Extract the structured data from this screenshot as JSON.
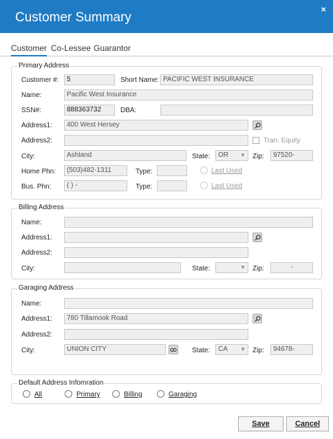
{
  "window": {
    "title": "Customer Summary",
    "close_glyph": "×"
  },
  "tabs": [
    "Customer",
    "Co-Lessee",
    "Guarantor"
  ],
  "primary": {
    "title": "Primary Address",
    "customer_no_label": "Customer #:",
    "customer_no": "5",
    "short_name_label": "Short Name:",
    "short_name": "PACIFIC WEST INSURANCE",
    "name_label": "Name:",
    "name": "Pacific West Insurance",
    "ssn_label": "SSN#:",
    "ssn": "888363732",
    "dba_label": "DBA:",
    "dba": "",
    "address1_label": "Address1:",
    "address1": "400 West Hersey",
    "address2_label": "Address2:",
    "address2": "",
    "tran_equity_label": "Tran. Equity",
    "city_label": "City:",
    "city": "Ashland",
    "state_label": "State:",
    "state": "OR",
    "zip_label": "Zip:",
    "zip": "97520-",
    "home_phn_label": "Home Phn:",
    "home_phn": "(503)482-1311",
    "type_label": "Type:",
    "home_type": "",
    "bus_phn_label": "Bus. Phn:",
    "bus_phn": "(  )   -",
    "bus_type": "",
    "last_used_label": "Last Used"
  },
  "billing": {
    "title": "Billing Address",
    "name_label": "Name:",
    "address1_label": "Address1:",
    "address2_label": "Address2:",
    "city_label": "City:",
    "state_label": "State:",
    "zip_label": "Zip:",
    "zip": "-"
  },
  "garaging": {
    "title": "Garaging Address",
    "name_label": "Name:",
    "address1_label": "Address1:",
    "address1": "780 Tillamook Road",
    "address2_label": "Address2:",
    "city_label": "City:",
    "city": "UNION CITY",
    "state_label": "State:",
    "state": "CA",
    "zip_label": "Zip:",
    "zip": "94678-"
  },
  "default_address": {
    "title": "Default Address Infomration",
    "options": [
      "All",
      "Primary",
      "Billing",
      "Garaging"
    ]
  },
  "buttons": {
    "save": "Save",
    "cancel": "Cancel"
  },
  "icons": {
    "search": "search-icon",
    "lookup": "lookup-icon",
    "dropdown": "chevron-down-icon"
  },
  "colors": {
    "titlebar": "#1f7bc4"
  }
}
